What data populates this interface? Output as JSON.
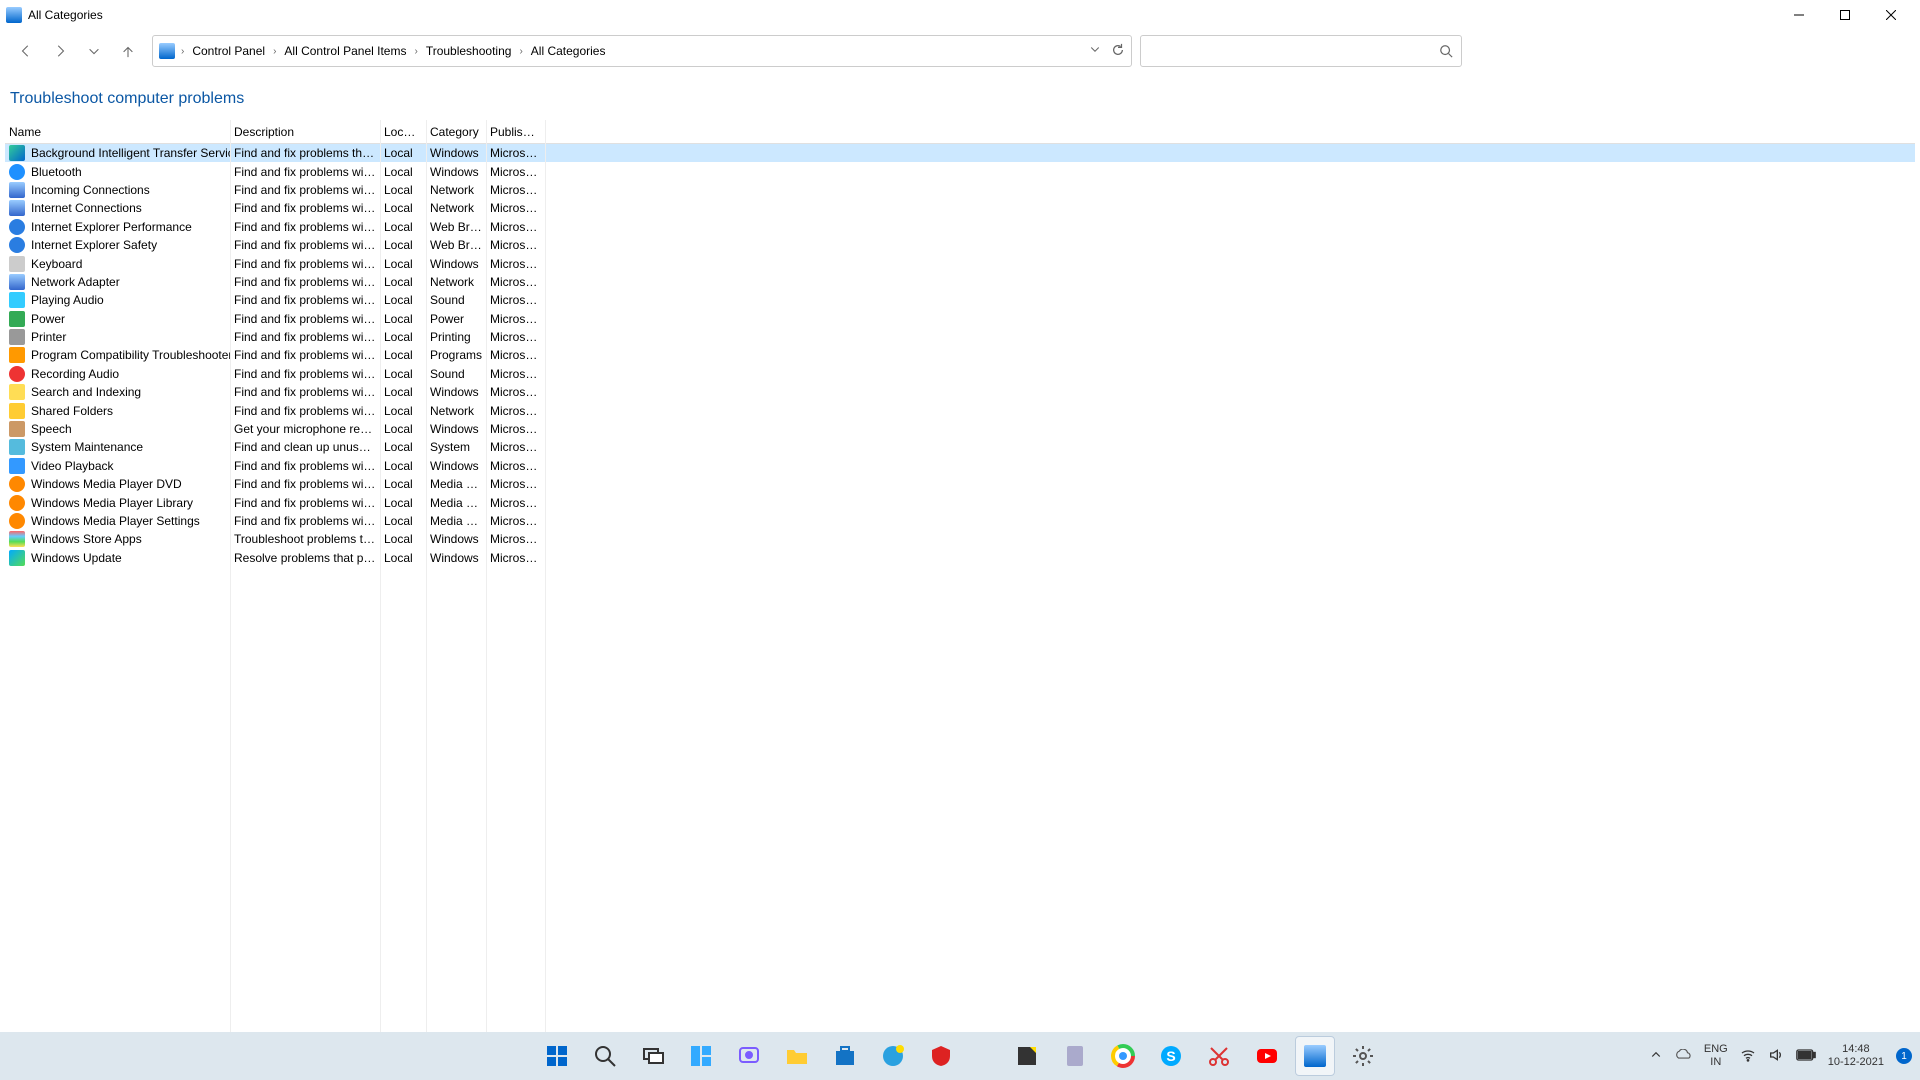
{
  "window": {
    "title": "All Categories"
  },
  "breadcrumbs": [
    "Control Panel",
    "All Control Panel Items",
    "Troubleshooting",
    "All Categories"
  ],
  "heading": "Troubleshoot computer problems",
  "columns": {
    "name": "Name",
    "description": "Description",
    "location": "Locat...",
    "category": "Category",
    "publisher": "Publisher"
  },
  "rows": [
    {
      "icon": "ic-bits",
      "name": "Background Intelligent Transfer Service",
      "desc": "Find and fix problems that...",
      "loc": "Local",
      "cat": "Windows",
      "pub": "Microso...",
      "selected": true
    },
    {
      "icon": "ic-bt",
      "name": "Bluetooth",
      "desc": "Find and fix problems with...",
      "loc": "Local",
      "cat": "Windows",
      "pub": "Microso..."
    },
    {
      "icon": "ic-net",
      "name": "Incoming Connections",
      "desc": "Find and fix problems with...",
      "loc": "Local",
      "cat": "Network",
      "pub": "Microso..."
    },
    {
      "icon": "ic-net",
      "name": "Internet Connections",
      "desc": "Find and fix problems with...",
      "loc": "Local",
      "cat": "Network",
      "pub": "Microso..."
    },
    {
      "icon": "ic-ie",
      "name": "Internet Explorer Performance",
      "desc": "Find and fix problems with...",
      "loc": "Local",
      "cat": "Web Bro...",
      "pub": "Microso..."
    },
    {
      "icon": "ic-ie",
      "name": "Internet Explorer Safety",
      "desc": "Find and fix problems with...",
      "loc": "Local",
      "cat": "Web Bro...",
      "pub": "Microso..."
    },
    {
      "icon": "ic-kbd",
      "name": "Keyboard",
      "desc": "Find and fix problems with...",
      "loc": "Local",
      "cat": "Windows",
      "pub": "Microso..."
    },
    {
      "icon": "ic-net",
      "name": "Network Adapter",
      "desc": "Find and fix problems with...",
      "loc": "Local",
      "cat": "Network",
      "pub": "Microso..."
    },
    {
      "icon": "ic-snd",
      "name": "Playing Audio",
      "desc": "Find and fix problems with...",
      "loc": "Local",
      "cat": "Sound",
      "pub": "Microso..."
    },
    {
      "icon": "ic-pwr",
      "name": "Power",
      "desc": "Find and fix problems with...",
      "loc": "Local",
      "cat": "Power",
      "pub": "Microso..."
    },
    {
      "icon": "ic-prn",
      "name": "Printer",
      "desc": "Find and fix problems with...",
      "loc": "Local",
      "cat": "Printing",
      "pub": "Microso..."
    },
    {
      "icon": "ic-prog",
      "name": "Program Compatibility Troubleshooter",
      "desc": "Find and fix problems with...",
      "loc": "Local",
      "cat": "Programs",
      "pub": "Microso..."
    },
    {
      "icon": "ic-rec",
      "name": "Recording Audio",
      "desc": "Find and fix problems with...",
      "loc": "Local",
      "cat": "Sound",
      "pub": "Microso..."
    },
    {
      "icon": "ic-srch",
      "name": "Search and Indexing",
      "desc": "Find and fix problems with...",
      "loc": "Local",
      "cat": "Windows",
      "pub": "Microso..."
    },
    {
      "icon": "ic-fld",
      "name": "Shared Folders",
      "desc": "Find and fix problems with...",
      "loc": "Local",
      "cat": "Network",
      "pub": "Microso..."
    },
    {
      "icon": "ic-spch",
      "name": "Speech",
      "desc": "Get your microphone read...",
      "loc": "Local",
      "cat": "Windows",
      "pub": "Microso..."
    },
    {
      "icon": "ic-sys",
      "name": "System Maintenance",
      "desc": "Find and clean up unused f...",
      "loc": "Local",
      "cat": "System",
      "pub": "Microso..."
    },
    {
      "icon": "ic-vid",
      "name": "Video Playback",
      "desc": "Find and fix problems with...",
      "loc": "Local",
      "cat": "Windows",
      "pub": "Microso..."
    },
    {
      "icon": "ic-wmp",
      "name": "Windows Media Player DVD",
      "desc": "Find and fix problems with...",
      "loc": "Local",
      "cat": "Media P...",
      "pub": "Microso..."
    },
    {
      "icon": "ic-wmp",
      "name": "Windows Media Player Library",
      "desc": "Find and fix problems with...",
      "loc": "Local",
      "cat": "Media P...",
      "pub": "Microso..."
    },
    {
      "icon": "ic-wmp",
      "name": "Windows Media Player Settings",
      "desc": "Find and fix problems with...",
      "loc": "Local",
      "cat": "Media P...",
      "pub": "Microso..."
    },
    {
      "icon": "ic-store",
      "name": "Windows Store Apps",
      "desc": "Troubleshoot problems th...",
      "loc": "Local",
      "cat": "Windows",
      "pub": "Microso..."
    },
    {
      "icon": "ic-upd",
      "name": "Windows Update",
      "desc": "Resolve problems that pre...",
      "loc": "Local",
      "cat": "Windows",
      "pub": "Microso..."
    }
  ],
  "taskbar": {
    "lang1": "ENG",
    "lang2": "IN",
    "time": "14:48",
    "date": "10-12-2021",
    "notif_count": "1"
  }
}
